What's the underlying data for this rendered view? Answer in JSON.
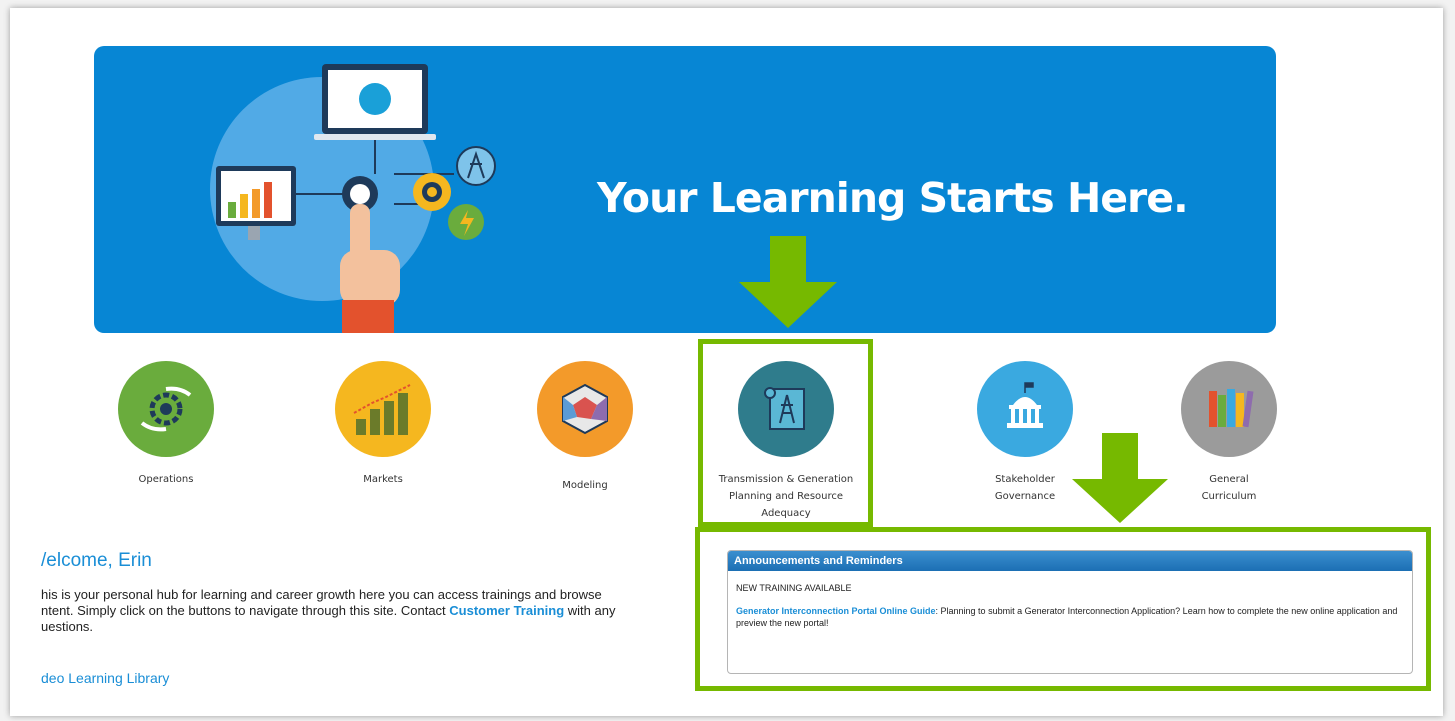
{
  "hero": {
    "title": "Your Learning Starts Here."
  },
  "categories": [
    {
      "label": "Operations",
      "color": "#6aac3d"
    },
    {
      "label": "Markets",
      "color": "#f5b71f"
    },
    {
      "label": "Modeling",
      "color": "#f39a2a"
    },
    {
      "label": "Transmission & Generation Planning and Resource Adequacy",
      "color": "#2f7c8c"
    },
    {
      "label": "Stakeholder Governance",
      "color": "#3aa9e0"
    },
    {
      "label": "General Curriculum",
      "color": "#9b9b9b"
    }
  ],
  "welcome": {
    "title": "/elcome, Erin",
    "line1": "his is your personal hub for learning and career growth here you can access trainings and browse",
    "line2_pre": "ntent. Simply click on the buttons to navigate through this site. Contact",
    "link": "Customer Training",
    "line2_post": "with any",
    "line3": "uestions."
  },
  "video_link": "deo Learning Library",
  "announcements": {
    "header": "Announcements and Reminders",
    "subtitle": "NEW TRAINING AVAILABLE",
    "link": "Generator Interconnection Portal Online Guide",
    "body": ": Planning to submit a Generator Interconnection Application? Learn how to complete the new online application and preview the new portal!"
  },
  "colors": {
    "accent": "#76b900",
    "hero": "#0786d4",
    "link": "#1a8ed6"
  }
}
